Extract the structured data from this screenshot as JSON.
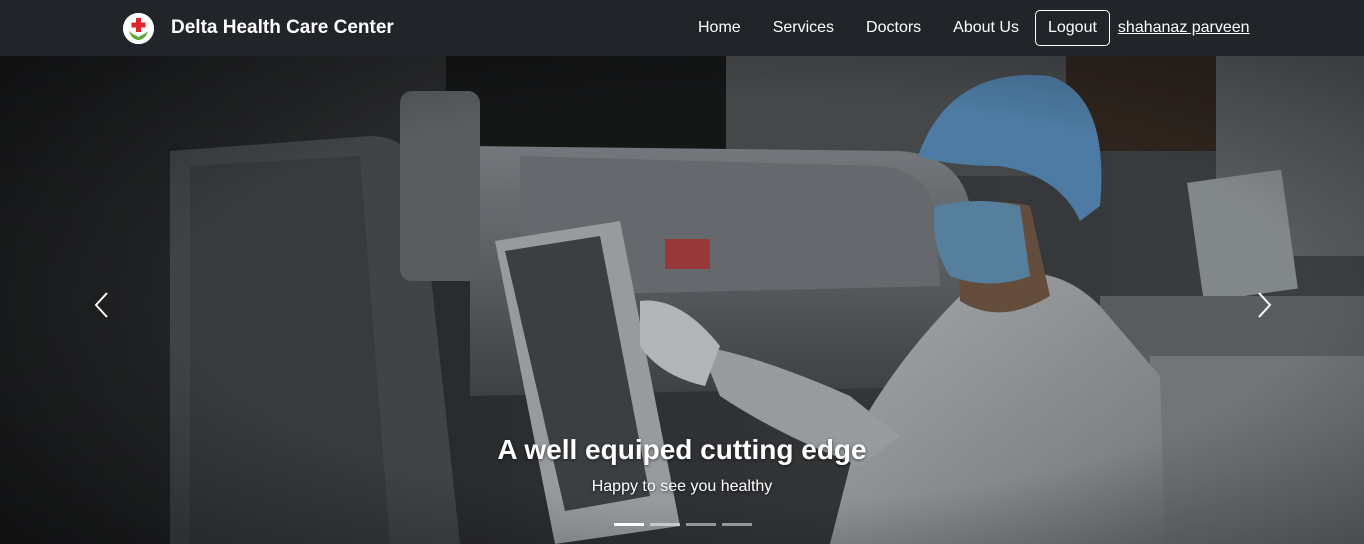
{
  "brand": {
    "name": "Delta Health Care Center",
    "logo_icon": "red-cross-logo-icon"
  },
  "nav": {
    "links": [
      "Home",
      "Services",
      "Doctors",
      "About Us"
    ],
    "logout_label": "Logout",
    "user_name": "shahanaz parveen"
  },
  "hero": {
    "title": "A well equiped cutting edge",
    "subtitle": "Happy to see you healthy",
    "prev_icon": "chevron-left-icon",
    "next_icon": "chevron-right-icon",
    "slide_count": 4,
    "active_slide": 1
  },
  "colors": {
    "navbar": "#212429",
    "text": "#ffffff",
    "logo_cross": "#e02626",
    "logo_leaf": "#5cab3c"
  }
}
